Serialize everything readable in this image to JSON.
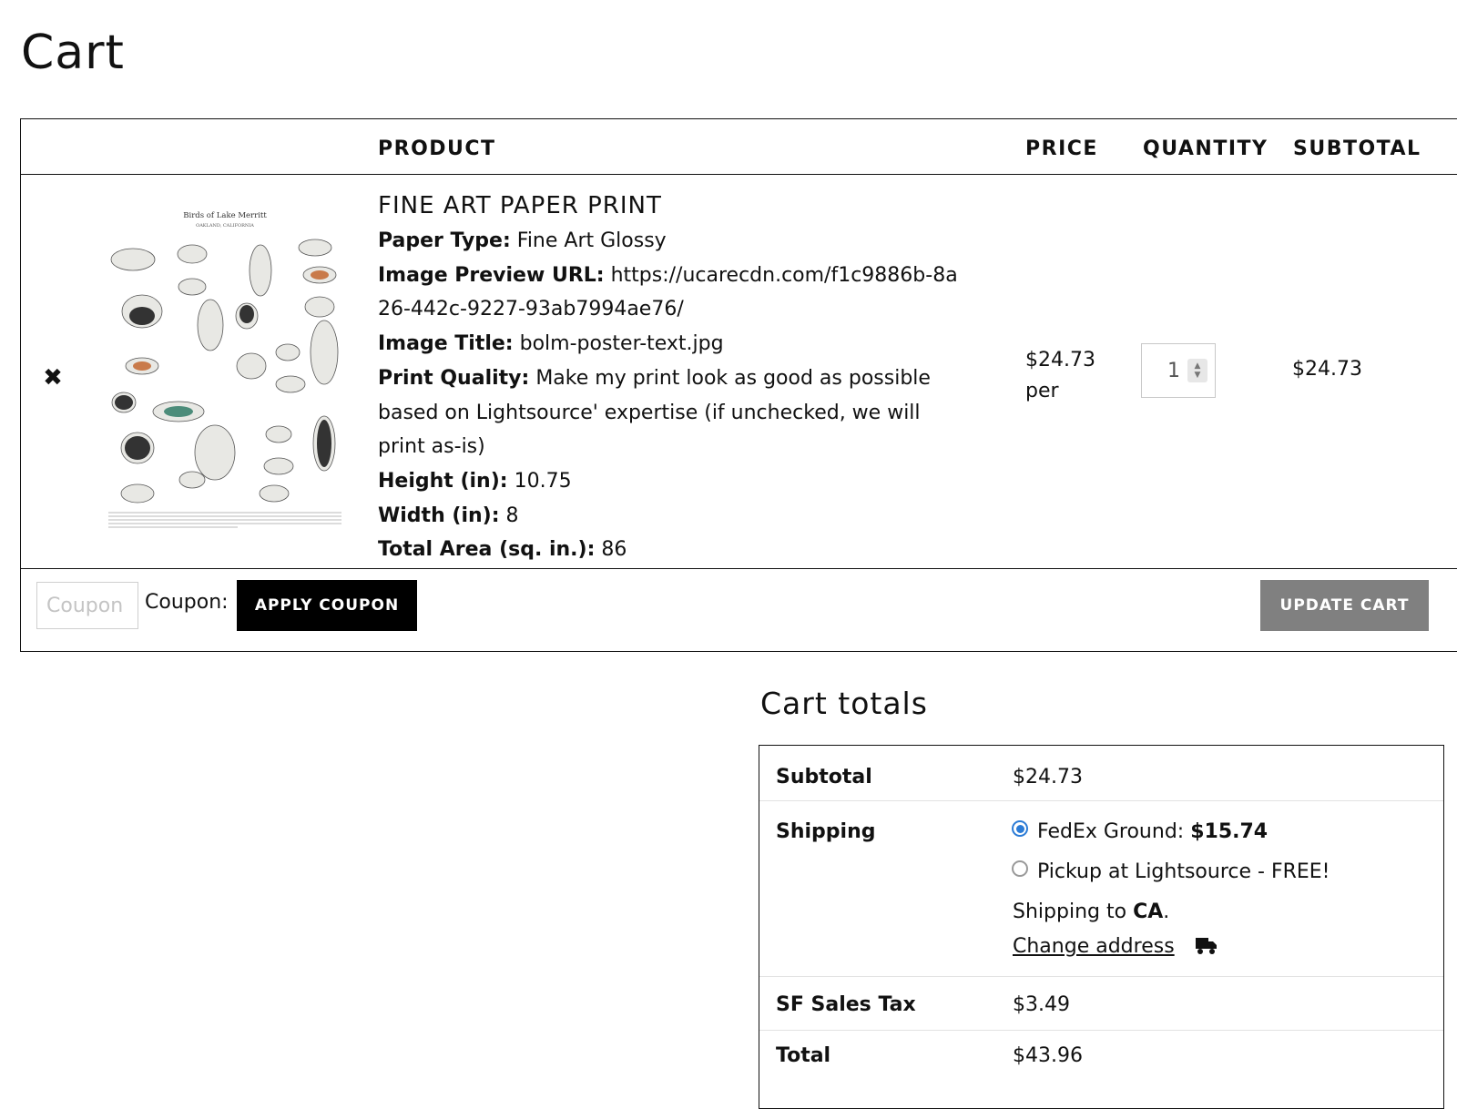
{
  "page": {
    "title": "Cart"
  },
  "cart_table": {
    "headers": {
      "product": "PRODUCT",
      "price": "PRICE",
      "quantity": "QUANTITY",
      "subtotal": "SUBTOTAL"
    },
    "item": {
      "remove_icon": "close-icon",
      "thumbnail": {
        "title": "Birds of Lake Merritt",
        "subtitle": "OAKLAND, CALIFORNIA"
      },
      "name": "FINE ART PAPER PRINT",
      "meta": [
        {
          "label": "Paper Type:",
          "value": "Fine Art Glossy"
        },
        {
          "label": "Image Preview URL:",
          "value": "https://ucarecdn.com/f1c9886b-8a26-442c-9227-93ab7994ae76/"
        },
        {
          "label": "Image Title:",
          "value": "bolm-poster-text.jpg"
        },
        {
          "label": "Print Quality:",
          "value": "Make my print look as good as possible based on Lightsource' expertise (if unchecked, we will print as-is)"
        },
        {
          "label": "Height (in):",
          "value": "10.75"
        },
        {
          "label": "Width (in):",
          "value": "8"
        },
        {
          "label": "Total Area (sq. in.):",
          "value": "86"
        }
      ],
      "price": "$24.73",
      "price_unit": "per",
      "quantity": "1",
      "subtotal": "$24.73"
    },
    "coupon": {
      "placeholder": "Coupon",
      "label": "Coupon:",
      "apply_button": "APPLY COUPON"
    },
    "update_button": "UPDATE CART"
  },
  "totals": {
    "title": "Cart totals",
    "subtotal_label": "Subtotal",
    "subtotal_value": "$24.73",
    "shipping_label": "Shipping",
    "shipping_options": [
      {
        "label": "FedEx Ground:",
        "price": "$15.74",
        "selected": true
      },
      {
        "label": "Pickup at Lightsource - FREE!",
        "selected": false
      }
    ],
    "shipping_to_prefix": "Shipping to",
    "shipping_to_region": "CA",
    "shipping_to_suffix": ".",
    "change_address": "Change address",
    "truck_icon": "truck-icon",
    "tax_label": "SF Sales Tax",
    "tax_value": "$3.49",
    "total_label": "Total",
    "total_value": "$43.96"
  },
  "colors": {
    "accent_radio": "#2b7bd6",
    "apply_button_bg": "#000000",
    "update_button_bg": "#808080"
  }
}
